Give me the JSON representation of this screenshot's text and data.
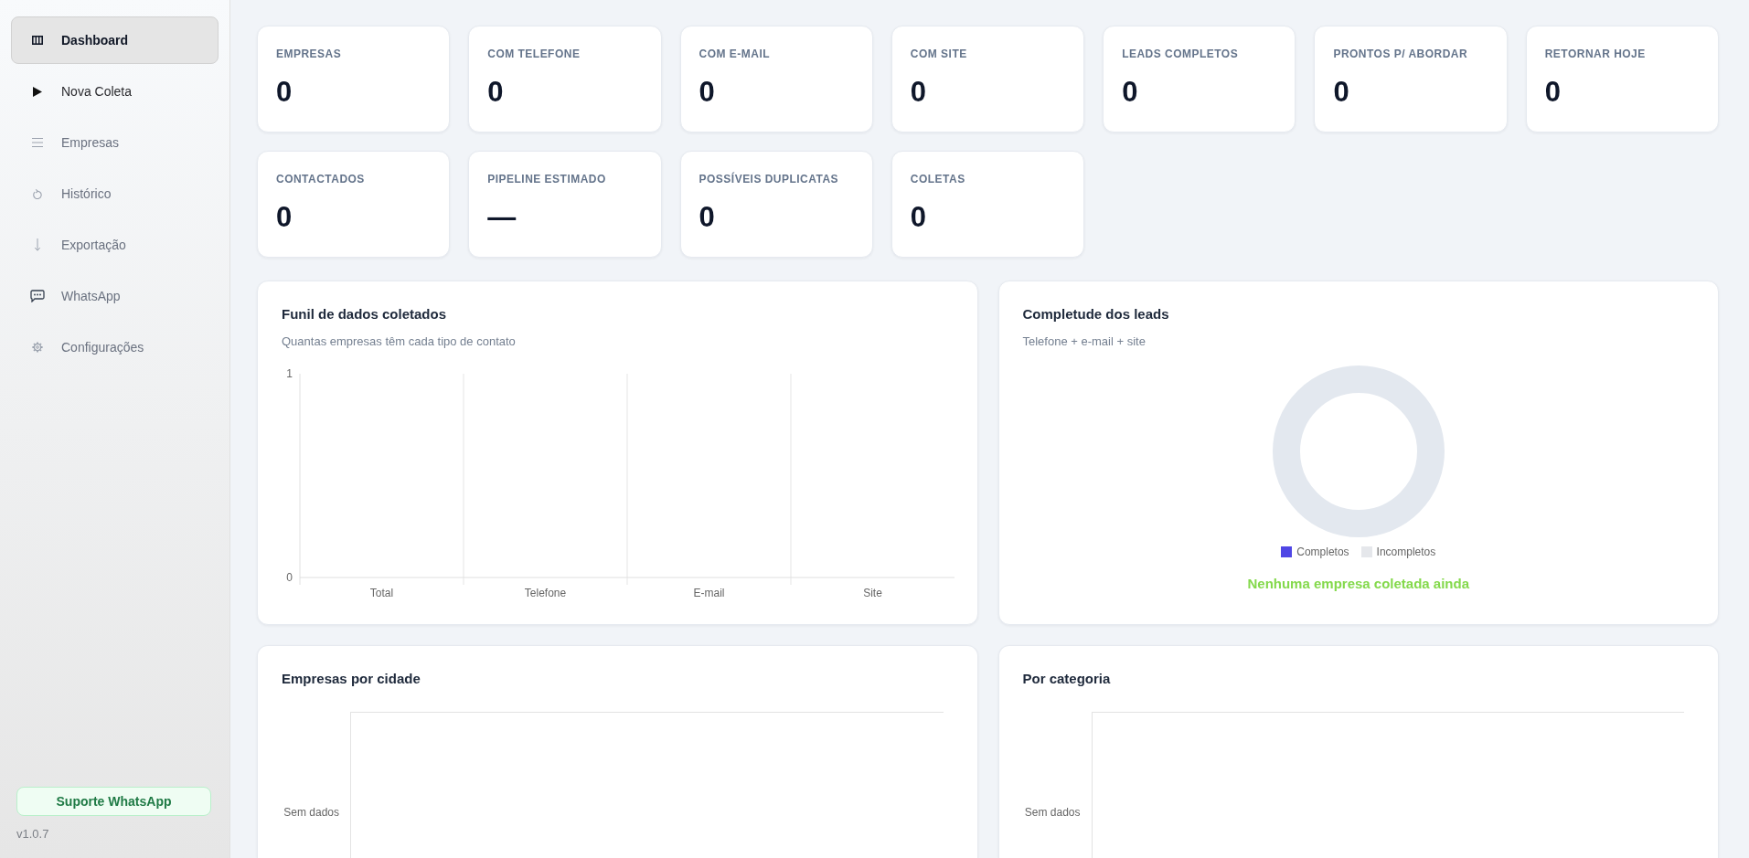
{
  "sidebar": {
    "items": [
      {
        "label": "Dashboard",
        "selected": true,
        "hovered": false
      },
      {
        "label": "Nova Coleta",
        "selected": false,
        "hovered": true
      },
      {
        "label": "Empresas",
        "selected": false,
        "hovered": false
      },
      {
        "label": "Histórico",
        "selected": false,
        "hovered": false
      },
      {
        "label": "Exportação",
        "selected": false,
        "hovered": false
      },
      {
        "label": "WhatsApp",
        "selected": false,
        "hovered": false
      },
      {
        "label": "Configurações",
        "selected": false,
        "hovered": false
      }
    ],
    "support_button": "Suporte WhatsApp",
    "version": "v1.0.7"
  },
  "stats": [
    {
      "label": "EMPRESAS",
      "value": "0"
    },
    {
      "label": "COM TELEFONE",
      "value": "0"
    },
    {
      "label": "COM E-MAIL",
      "value": "0"
    },
    {
      "label": "COM SITE",
      "value": "0"
    },
    {
      "label": "LEADS COMPLETOS",
      "value": "0"
    },
    {
      "label": "PRONTOS P/ ABORDAR",
      "value": "0"
    },
    {
      "label": "RETORNAR HOJE",
      "value": "0"
    },
    {
      "label": "CONTACTADOS",
      "value": "0"
    },
    {
      "label": "PIPELINE ESTIMADO",
      "value": "—"
    },
    {
      "label": "POSSÍVEIS DUPLICATAS",
      "value": "0"
    },
    {
      "label": "COLETAS",
      "value": "0"
    }
  ],
  "funnel_card": {
    "title": "Funil de dados coletados",
    "subtitle": "Quantas empresas têm cada tipo de contato",
    "chart_data": {
      "type": "bar",
      "categories": [
        "Total",
        "Telefone",
        "E-mail",
        "Site"
      ],
      "values": [
        0,
        0,
        0,
        0
      ],
      "ylim": [
        0,
        1
      ],
      "yticks": [
        0,
        1
      ]
    }
  },
  "completeness_card": {
    "title": "Completude dos leads",
    "subtitle": "Telefone + e-mail + site",
    "legend": [
      {
        "label": "Completos",
        "color": "#4f46e5"
      },
      {
        "label": "Incompletos",
        "color": "#e5e7eb"
      }
    ],
    "message": "Nenhuma empresa coletada ainda"
  },
  "city_card": {
    "title": "Empresas por cidade",
    "axis_label": "Sem dados"
  },
  "category_card": {
    "title": "Por categoria",
    "axis_label": "Sem dados"
  }
}
